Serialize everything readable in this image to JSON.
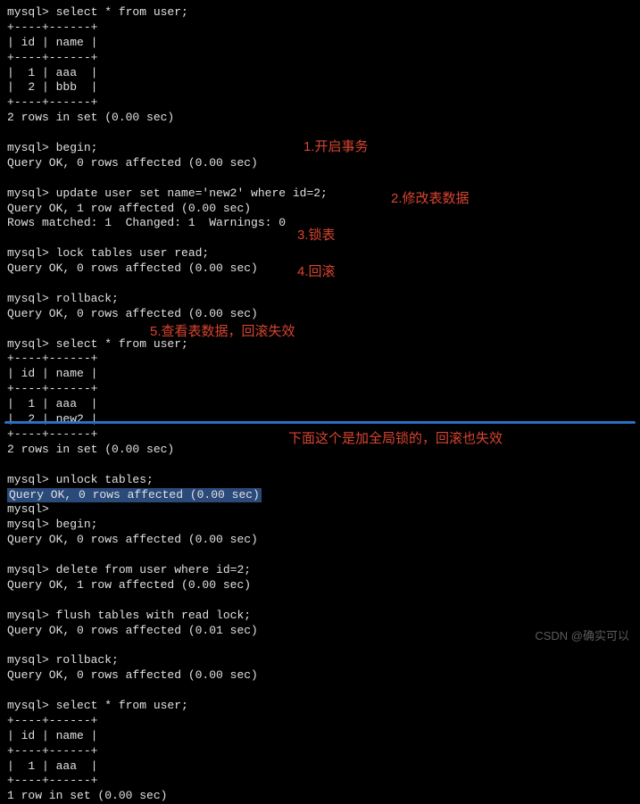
{
  "terminal": {
    "block1": "mysql> select * from user;\n+----+------+\n| id | name |\n+----+------+\n|  1 | aaa  |\n|  2 | bbb  |\n+----+------+\n2 rows in set (0.00 sec)\n\nmysql> begin;\nQuery OK, 0 rows affected (0.00 sec)\n\nmysql> update user set name='new2' where id=2;\nQuery OK, 1 row affected (0.00 sec)\nRows matched: 1  Changed: 1  Warnings: 0\n\nmysql> lock tables user read;\nQuery OK, 0 rows affected (0.00 sec)\n\nmysql> rollback;\nQuery OK, 0 rows affected (0.00 sec)\n\nmysql> select * from user;\n+----+------+\n| id | name |\n+----+------+\n|  1 | aaa  |\n|  2 | new2 |\n+----+------+\n2 rows in set (0.00 sec)\n\nmysql> unlock tables;",
    "highlighted": "Query OK, 0 rows affected (0.00 sec)",
    "block2": "\nmysql>\nmysql> begin;\nQuery OK, 0 rows affected (0.00 sec)\n\nmysql> delete from user where id=2;\nQuery OK, 1 row affected (0.00 sec)\n\nmysql> flush tables with read lock;\nQuery OK, 0 rows affected (0.01 sec)\n\nmysql> rollback;\nQuery OK, 0 rows affected (0.00 sec)\n\nmysql> select * from user;\n+----+------+\n| id | name |\n+----+------+\n|  1 | aaa  |\n+----+------+\n1 row in set (0.00 sec)\n"
  },
  "annotations": {
    "a1": "1.开启事务",
    "a2": "2.修改表数据",
    "a3": "3.锁表",
    "a4": "4.回滚",
    "a5": "5.查看表数据，回滚失效",
    "a6": "下面这个是加全局锁的，回滚也失效"
  },
  "watermark": "CSDN @确实可以"
}
